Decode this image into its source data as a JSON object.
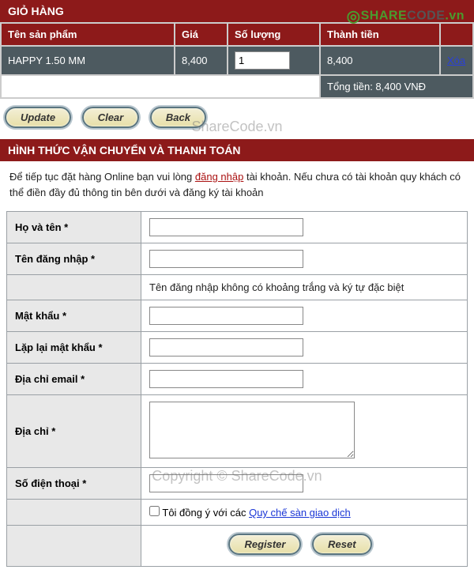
{
  "watermark": {
    "brand_share": "SHARE",
    "brand_code": "CODE",
    "brand_tld": ".vn",
    "center_text": "ShareCode.vn",
    "bottom_text": "Copyright © ShareCode.vn"
  },
  "cart": {
    "title": "GIỎ HÀNG",
    "headers": {
      "name": "Tên sản phẩm",
      "price": "Giá",
      "qty": "Số lượng",
      "total": "Thành tiền"
    },
    "rows": [
      {
        "name": "HAPPY 1.50 MM",
        "price": "8,400",
        "qty": "1",
        "total": "8,400",
        "action": "Xóa"
      }
    ],
    "grand_total_label": "Tổng tiền: 8,400 VNĐ"
  },
  "buttons": {
    "update": "Update",
    "clear": "Clear",
    "back": "Back",
    "register": "Register",
    "reset": "Reset"
  },
  "shipping": {
    "title": "HÌNH THỨC VẬN CHUYỂN VÀ THANH TOÁN",
    "instr_pre": "Để tiếp tục đặt hàng Online bạn vui lòng ",
    "instr_link": "đăng nhập",
    "instr_post": " tài khoản. Nếu chưa có tài khoản quy khách có thể điền đầy đủ thông tin bên dưới và đăng ký tài khoản"
  },
  "form": {
    "fullname": "Họ và tên *",
    "username": "Tên đăng nhập *",
    "username_hint": "Tên đăng nhập không có khoảng trắng và ký tự đặc biệt",
    "password": "Mật khẩu *",
    "password2": "Lặp lại mật khẩu *",
    "email": "Địa chỉ email *",
    "address": "Địa chỉ *",
    "phone": "Số điện thoại *",
    "agree_pre": "Tôi đồng ý với các ",
    "agree_link": "Quy chế sàn giao dịch"
  }
}
